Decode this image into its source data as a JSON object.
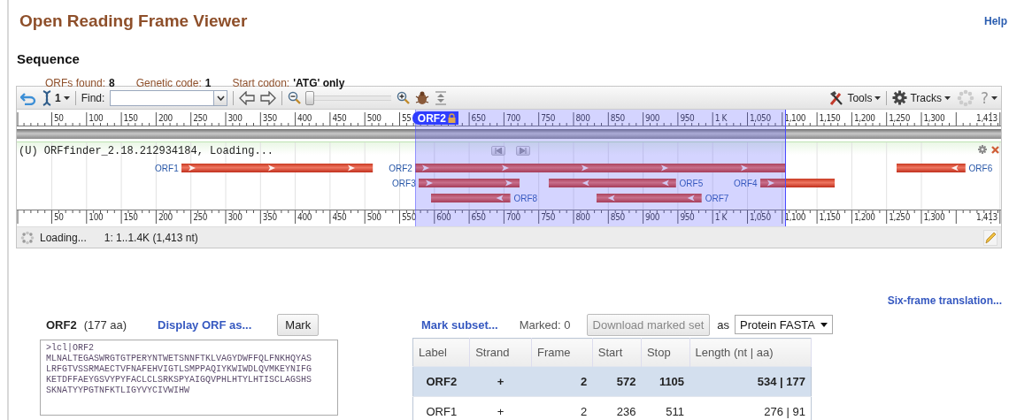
{
  "header": {
    "title": "Open Reading Frame Viewer",
    "help_link": "Help"
  },
  "section_title": "Sequence",
  "summary": [
    {
      "label": "ORFs found:",
      "value": "8"
    },
    {
      "label": "Genetic code:",
      "value": "1"
    },
    {
      "label": "Start codon:",
      "value": "'ATG' only"
    }
  ],
  "viewer": {
    "toolbar": {
      "strand_value": "1",
      "find_label": "Find:",
      "zoom_slider": {
        "level": 0
      },
      "tools_menu": "Tools",
      "tracks_menu": "Tracks",
      "help_menu": "?"
    },
    "top_ruler": [
      "50",
      "100",
      "150",
      "200",
      "250",
      "300",
      "350",
      "400",
      "450",
      "500",
      "55",
      "650",
      "700",
      "750",
      "800",
      "850",
      "900",
      "950",
      "1 K",
      "1,050",
      "1,100",
      "1,150",
      "1,200",
      "1,250",
      "1,300",
      "1,413"
    ],
    "selection_badge": "ORF2",
    "track": {
      "title": "(U) ORFfinder_2.18.212934184, Loading...",
      "features": [
        {
          "label": "ORF1",
          "reverse": false
        },
        {
          "label": "ORF2",
          "reverse": false
        },
        {
          "label": "ORF6",
          "reverse": true
        },
        {
          "label": "ORF3",
          "reverse": false
        },
        {
          "label": "ORF5",
          "reverse": true
        },
        {
          "label": "ORF4",
          "reverse": false
        },
        {
          "label": "ORF8",
          "reverse": true
        },
        {
          "label": "ORF7",
          "reverse": true
        }
      ]
    },
    "bottom_ruler": [
      "50",
      "100",
      "150",
      "200",
      "250",
      "300",
      "350",
      "400",
      "450",
      "500",
      "550",
      "600",
      "650",
      "700",
      "750",
      "800",
      "850",
      "900",
      "950",
      "1 K",
      "1,050",
      "1,100",
      "1,150",
      "1,200",
      "1,250",
      "1,300",
      "1,413"
    ],
    "status": {
      "message": "Loading...",
      "range": "1: 1..1.4K (1,413 nt)"
    }
  },
  "details": {
    "six_frame_link": "Six-frame translation...",
    "orf_name": "ORF2",
    "orf_length": "(177 aa)",
    "display_link": "Display ORF as...",
    "mark_button": "Mark",
    "sequence": ">lcl|ORF2\nMLNALTEGASWRGTGTPERYNTWETSNNFTKLVAGYDWFFQLFNKHQYAS\nLRFGTVSSRMAECTVFNAFEHVIGTLSMPPAQIYKWIWDLQVMKEYNIFG\nKETDFFAEYGSVYPYFACLCLSRKSPYAIGQVPHLHTYLHTISCLAGSHS\nSKNATYYPGTNFKTLIGYVYCIVWIHW",
    "mark_subset_link": "Mark subset...",
    "marked_count": "Marked: 0",
    "download_button": {
      "label": "Download marked set",
      "disabled": true
    },
    "as_label": "as",
    "format_select": "Protein FASTA",
    "table": {
      "columns": [
        "Label",
        "Strand",
        "Frame",
        "Start",
        "Stop",
        "Length (nt | aa)"
      ],
      "rows": [
        {
          "label": "ORF2",
          "strand": "+",
          "frame": "2",
          "start": "572",
          "stop": "1105",
          "length": "534 | 177",
          "selected": true
        },
        {
          "label": "ORF1",
          "strand": "+",
          "frame": "2",
          "start": "236",
          "stop": "511",
          "length": "276 | 91",
          "selected": false
        }
      ]
    }
  }
}
